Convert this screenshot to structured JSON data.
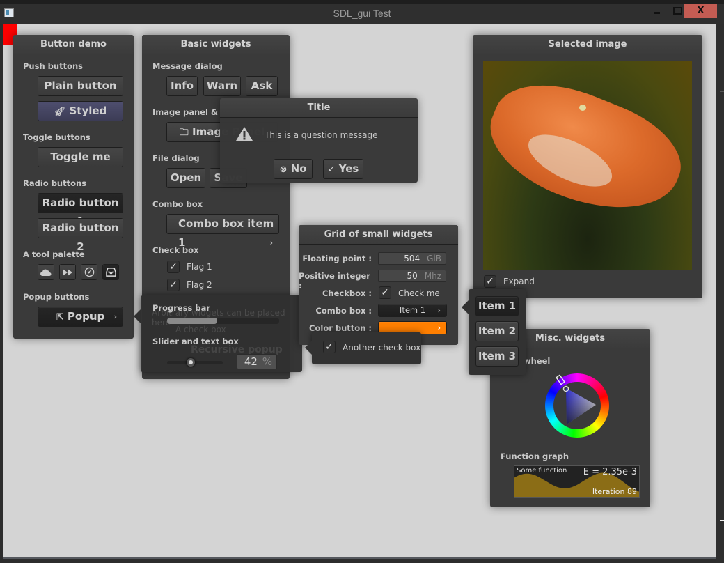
{
  "window": {
    "title": "SDL_gui Test",
    "controls": {
      "minimize": "_",
      "maximize": "□",
      "close": "X"
    }
  },
  "button_demo": {
    "title": "Button demo",
    "push_label": "Push buttons",
    "plain_button": "Plain button",
    "styled_button": "Styled",
    "styled_icon": "rocket-icon",
    "styled_color": "#45455f",
    "toggle_label": "Toggle buttons",
    "toggle_button": "Toggle me",
    "radio_label": "Radio buttons",
    "radio_1": "Radio button 1",
    "radio_2": "Radio button 2",
    "radio_selected": "Radio button 1",
    "palette_label": "A tool palette",
    "palette_tools": [
      "cloud-icon",
      "fast-forward-icon",
      "compass-icon",
      "inbox-icon"
    ],
    "palette_selected": "inbox-icon",
    "popup_label": "Popup buttons",
    "popup_button": "Popup",
    "popup_icon": "export-icon"
  },
  "basic_widgets": {
    "title": "Basic widgets",
    "message_label": "Message dialog",
    "info": "Info",
    "warn": "Warn",
    "ask": "Ask",
    "image_label": "Image panel & scroll panel",
    "image_label_visible": "Image panel & scr",
    "image_button": "Image Panel",
    "file_label": "File dialog",
    "open": "Open",
    "save": "Save",
    "combo_label": "Combo box",
    "combo_value": "Combo box item 1",
    "check_label": "Check box",
    "flag1": "Flag 1",
    "flag2": "Flag 2",
    "flag1_checked": true,
    "flag2_checked": true
  },
  "popup_panel": {
    "ghost_text": "Arbitrary widgets can be placed here",
    "ghost_check": "A check box",
    "ghost_recursive": "Recursive popup",
    "progress_label": "Progress bar",
    "progress_fraction": 0.45,
    "slider_label": "Slider and text box",
    "slider_value": 0.42,
    "slider_text": "42",
    "slider_unit": "%"
  },
  "dialog": {
    "title": "Title",
    "message": "This is a question message",
    "icon": "warning-icon",
    "no": "No",
    "yes": "Yes"
  },
  "grid": {
    "title": "Grid of small widgets",
    "float_label": "Floating point :",
    "float_value": "504",
    "float_unit": "GiB",
    "int_label": "Positive integer :",
    "int_value": "50",
    "int_unit": "Mhz",
    "checkbox_label": "Checkbox :",
    "checkbox_text": "Check me",
    "checkbox_checked": true,
    "combo_label": "Combo box :",
    "combo_value": "Item 1",
    "color_label": "Color button :",
    "color_value": "#ff7f00"
  },
  "another_popup": {
    "text": "Another check box",
    "checked": true
  },
  "combo_popup": {
    "items": [
      "Item 1",
      "Item 2",
      "Item 3"
    ],
    "selected": "Item 1"
  },
  "selected_image": {
    "title": "Selected image",
    "expand": "Expand",
    "expand_checked": true
  },
  "misc": {
    "title": "Misc. widgets",
    "wheel_label_visible": "wheel",
    "wheel_label": "Color wheel",
    "graph_label": "Function graph",
    "graph_caption": "Some function",
    "graph_header": "E = 2.35e-3",
    "graph_footer": "Iteration 89",
    "graph_fill": "#8b6d16"
  }
}
